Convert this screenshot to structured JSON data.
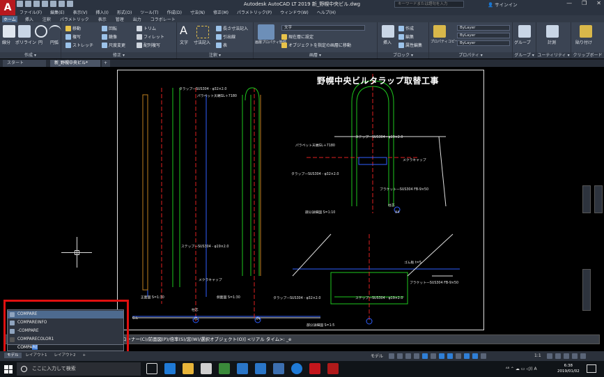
{
  "window": {
    "logo": "A",
    "title": "Autodesk AutoCAD LT 2019   新_野幌中央ビル.dwg",
    "search_placeholder": "キーワードまたは語句を入力",
    "signin": "サインイン",
    "controls": [
      "—",
      "❐",
      "✕"
    ]
  },
  "menubar": [
    "ファイル(F)",
    "編集(E)",
    "表示(V)",
    "挿入(I)",
    "形式(O)",
    "ツール(T)",
    "作成(D)",
    "寸法(N)",
    "修正(M)",
    "パラメトリック(P)",
    "ウィンドウ(W)",
    "ヘルプ(H)"
  ],
  "ribbon_tabs": [
    {
      "label": "ホーム",
      "active": true
    },
    {
      "label": "挿入"
    },
    {
      "label": "注釈"
    },
    {
      "label": "パラメトリック"
    },
    {
      "label": "表示"
    },
    {
      "label": "管理"
    },
    {
      "label": "出力"
    },
    {
      "label": "コラボレート"
    }
  ],
  "ribbon": {
    "draw": {
      "title": "作成 ▾",
      "line": "線分",
      "polyline": "ポリライン",
      "circle": "円",
      "arc": "円弧"
    },
    "modify": {
      "title": "修正 ▾",
      "move": "移動",
      "copy": "複写",
      "stretch": "ストレッチ",
      "rotate": "回転",
      "mirror": "鏡像",
      "scale": "尺度変更",
      "trim": "トリム",
      "fillet": "フィレット",
      "array": "配列複写"
    },
    "annotation": {
      "title": "注釈 ▾",
      "text": "文字",
      "dimension": "寸法記入",
      "linear": "長さ寸法記入",
      "leader": "引出線",
      "table": "表"
    },
    "layers": {
      "title": "画層 ▾",
      "props": "画層プロパティ管理",
      "current_layer": "文字",
      "set_current": "現在層に設定",
      "match": "オブジェクトを指定の画層に移動"
    },
    "block": {
      "title": "ブロック ▾",
      "insert": "挿入",
      "create": "作成",
      "edit": "編集",
      "attr": "属性編集"
    },
    "properties": {
      "title": "プロパティ ▾",
      "match": "プロパティコピー",
      "bylayer1": "ByLayer",
      "bylayer2": "ByLayer",
      "bylayer3": "ByLayer"
    },
    "groups": {
      "title": "グループ ▾",
      "group": "グループ"
    },
    "utilities": {
      "title": "ユーティリティ ▾",
      "measure": "計測"
    },
    "clipboard": {
      "title": "クリップボード",
      "paste": "貼り付け"
    }
  },
  "file_tabs": {
    "start": "スタート",
    "doc": "新_野幌中央ビル*",
    "plus": "+"
  },
  "drawing": {
    "title": "野幌中央ビルタラップ取替工事",
    "labels": {
      "l1": "タラップ一SUS304 - φ32×2.0",
      "l2": "パラペット天端GL＋7180",
      "l3": "ステップ一SUS304 - φ19×2.0",
      "l4": "メクラキャップ",
      "l5": "正面図  S=1:30",
      "l6": "側面図  S=1:30",
      "l7": "柱芯",
      "l8": "X1",
      "l9": "X4",
      "l10": "G.L",
      "l11": "ステップ一SUS304 - φ19×2.0",
      "l12": "パラペット天端GL＋7180",
      "l13": "メクラキャップ",
      "l14": "タラップ一SUS304 - φ32×2.0",
      "l15": "ブラケット一SUS304  FB-9×50",
      "l16": "部分詳細図  S=1:10",
      "l17": "柱芯",
      "l18": "X4",
      "l19": "ゴム板  t=5",
      "l20": "ブラケット一SUS304  FB-9×50",
      "l21": "タラップ一SUS304 - φ32×2.0",
      "l22": "ステップ一SUS304 - φ19×2.0",
      "l23": "部分詳細図  S=1:5"
    }
  },
  "command": {
    "prompt_text": "コーナー(C)/前面図(P)/倍率(S)/窓(W)/選択オブジェクト(O)] <リアル タイム>: _e",
    "suggestions": [
      "COMPARE",
      "COMPAREINFO",
      "-COMPARE",
      "COMPARECOLOR1"
    ],
    "input_prefix": "COMPA",
    "input_highlight": "RE"
  },
  "layout_tabs": [
    "モデル",
    "レイアウト1",
    "レイアウト2",
    "+"
  ],
  "status": {
    "model": "モデル",
    "scale": "1:1"
  },
  "taskbar": {
    "search_placeholder": "ここに入力して検索",
    "tray_text": "ᴬ⁸  ⌃ ☁ ▭ ◁)) A",
    "time": "6:38",
    "date": "2019/01/02"
  },
  "colors": {
    "titlebar": "#2b3340",
    "ribbon": "#3b4453",
    "highlight_box": "#e01010",
    "drawing_green": "#1ec81e",
    "drawing_red": "#e02020",
    "drawing_yellow": "#ffd400",
    "drawing_blue": "#2f5fff"
  }
}
